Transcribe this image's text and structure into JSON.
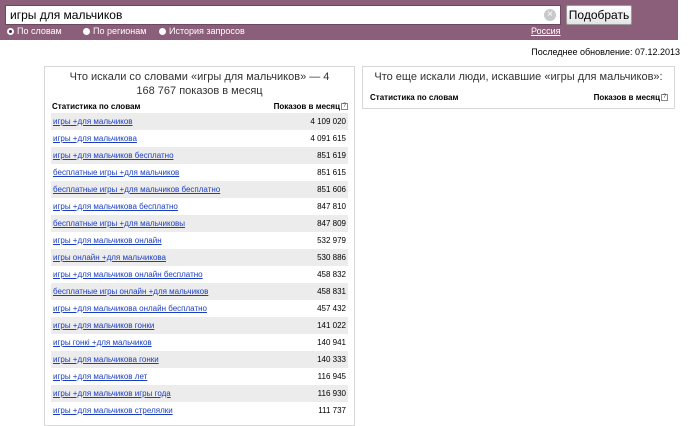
{
  "search": {
    "query": "игры для мальчиков",
    "clear_glyph": "×",
    "submit_label": "Подобрать",
    "radios": [
      {
        "label": "По словам",
        "selected": true
      },
      {
        "label": "По регионам",
        "selected": false
      },
      {
        "label": "История запросов",
        "selected": false
      }
    ],
    "region": "Россия"
  },
  "updated": "Последнее обновление: 07.12.2013",
  "left_panel": {
    "title": "Что искали со словами «игры для мальчиков» — 4 168 767 показов в месяц",
    "col_words": "Статистика по словам",
    "col_shows": "Показов в месяц",
    "help_glyph": "?",
    "rows": [
      {
        "phrase": "игры +для мальчиков",
        "count": "4 109 020"
      },
      {
        "phrase": "игры +для мальчикова",
        "count": "4 091 615"
      },
      {
        "phrase": "игры +для мальчиков бесплатно",
        "count": "851 619"
      },
      {
        "phrase": "бесплатные игры +для мальчиков",
        "count": "851 615"
      },
      {
        "phrase": "бесплатные игры +для мальчиков бесплатно",
        "count": "851 606"
      },
      {
        "phrase": "игры +для мальчикова бесплатно",
        "count": "847 810"
      },
      {
        "phrase": "бесплатные игры +для мальчиковы",
        "count": "847 809"
      },
      {
        "phrase": "игры +для мальчиков онлайн",
        "count": "532 979"
      },
      {
        "phrase": "игры онлайн +для мальчикова",
        "count": "530 886"
      },
      {
        "phrase": "игры +для мальчиков онлайн бесплатно",
        "count": "458 832"
      },
      {
        "phrase": "бесплатные игры онлайн +для мальчиков",
        "count": "458 831"
      },
      {
        "phrase": "игры +для мальчикова онлайн бесплатно",
        "count": "457 432"
      },
      {
        "phrase": "игры +для мальчиков гонки",
        "count": "141 022"
      },
      {
        "phrase": "игры гонкі +для мальчиков",
        "count": "140 941"
      },
      {
        "phrase": "игры +для мальчикова гонки",
        "count": "140 333"
      },
      {
        "phrase": "игры +для мальчиков лет",
        "count": "116 945"
      },
      {
        "phrase": "игры +для мальчиков игры года",
        "count": "116 930"
      },
      {
        "phrase": "игры +для мальчиков стрелялки",
        "count": "111 737"
      }
    ]
  },
  "right_panel": {
    "title": "Что еще искали люди, искавшие «игры для мальчиков»:",
    "col_words": "Статистика по словам",
    "col_shows": "Показов в месяц",
    "help_glyph": "?"
  },
  "colors": {
    "topbar": "#8b5e7a",
    "link": "#1a3dc1",
    "row_stripe": "#ececec"
  }
}
